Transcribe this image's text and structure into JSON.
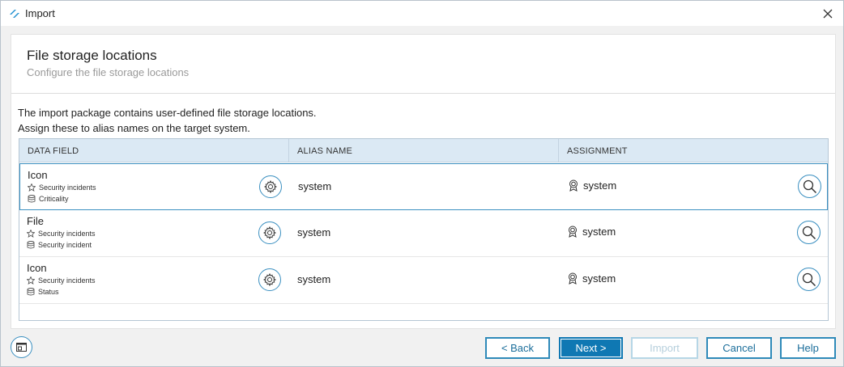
{
  "window": {
    "title": "Import",
    "accent": "#0f78b3"
  },
  "header": {
    "title": "File storage locations",
    "subtitle": "Configure the file storage locations"
  },
  "description": {
    "line1": "The import package contains user-defined file storage locations.",
    "line2": "Assign these to alias names on the target system."
  },
  "grid": {
    "columns": [
      "DATA FIELD",
      "ALIAS NAME",
      "ASSIGNMENT"
    ],
    "rows": [
      {
        "field": "Icon",
        "app": "Security incidents",
        "table": "Criticality",
        "alias": "system",
        "assignment": "system",
        "selected": true
      },
      {
        "field": "File",
        "app": "Security incidents",
        "table": "Security incident",
        "alias": "system",
        "assignment": "system",
        "selected": false
      },
      {
        "field": "Icon",
        "app": "Security incidents",
        "table": "Status",
        "alias": "system",
        "assignment": "system",
        "selected": false
      }
    ]
  },
  "footer": {
    "back": "< Back",
    "next": "Next >",
    "import": "Import",
    "cancel": "Cancel",
    "help": "Help"
  },
  "icons": {
    "app": "app-logo-icon",
    "close": "close-icon",
    "gear": "gear-icon",
    "search": "search-icon",
    "badge": "award-icon",
    "application": "apps-icon",
    "database": "database-icon",
    "window": "window-icon"
  }
}
